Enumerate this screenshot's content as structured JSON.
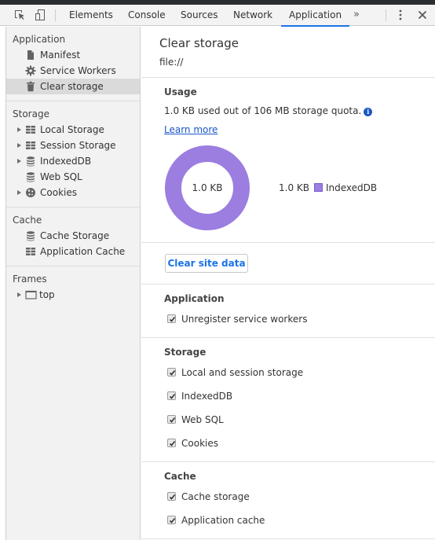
{
  "devtools": {
    "toolbar": {
      "inspect_icon": "element-picker-icon",
      "device_icon": "device-toolbar-icon",
      "tabs": [
        {
          "label": "Elements",
          "active": false
        },
        {
          "label": "Console",
          "active": false
        },
        {
          "label": "Sources",
          "active": false
        },
        {
          "label": "Network",
          "active": false
        },
        {
          "label": "Application",
          "active": true
        }
      ],
      "more_tabs": "»",
      "menu_icon": "kebab-menu-icon",
      "close_icon": "close-icon"
    },
    "sidebar": {
      "sections": [
        {
          "title": "Application",
          "items": [
            {
              "label": "Manifest",
              "icon": "document-icon",
              "expandable": false,
              "selected": false
            },
            {
              "label": "Service Workers",
              "icon": "gear-icon",
              "expandable": false,
              "selected": false
            },
            {
              "label": "Clear storage",
              "icon": "trash-icon",
              "expandable": false,
              "selected": true
            }
          ]
        },
        {
          "title": "Storage",
          "items": [
            {
              "label": "Local Storage",
              "icon": "grid-icon",
              "expandable": true,
              "selected": false
            },
            {
              "label": "Session Storage",
              "icon": "grid-icon",
              "expandable": true,
              "selected": false
            },
            {
              "label": "IndexedDB",
              "icon": "database-icon",
              "expandable": true,
              "selected": false
            },
            {
              "label": "Web SQL",
              "icon": "database-icon",
              "expandable": false,
              "selected": false
            },
            {
              "label": "Cookies",
              "icon": "cookie-icon",
              "expandable": true,
              "selected": false
            }
          ]
        },
        {
          "title": "Cache",
          "items": [
            {
              "label": "Cache Storage",
              "icon": "database-icon",
              "expandable": false,
              "selected": false
            },
            {
              "label": "Application Cache",
              "icon": "grid-icon",
              "expandable": false,
              "selected": false
            }
          ]
        },
        {
          "title": "Frames",
          "items": [
            {
              "label": "top",
              "icon": "frame-icon",
              "expandable": true,
              "selected": false
            }
          ]
        }
      ]
    },
    "main": {
      "title": "Clear storage",
      "origin": "file://",
      "usage": {
        "title": "Usage",
        "summary": "1.0 KB used out of 106 MB storage quota.",
        "learn_more": "Learn more",
        "chart_center": "1.0 KB",
        "legend_value": "1.0 KB",
        "legend_label": "IndexedDB",
        "legend_color": "#9b7ee0"
      },
      "clear_button": "Clear site data",
      "groups": [
        {
          "title": "Application",
          "options": [
            {
              "label": "Unregister service workers",
              "checked": true
            }
          ]
        },
        {
          "title": "Storage",
          "options": [
            {
              "label": "Local and session storage",
              "checked": true
            },
            {
              "label": "IndexedDB",
              "checked": true
            },
            {
              "label": "Web SQL",
              "checked": true
            },
            {
              "label": "Cookies",
              "checked": true
            }
          ]
        },
        {
          "title": "Cache",
          "options": [
            {
              "label": "Cache storage",
              "checked": true
            },
            {
              "label": "Application cache",
              "checked": true
            }
          ]
        }
      ]
    }
  }
}
